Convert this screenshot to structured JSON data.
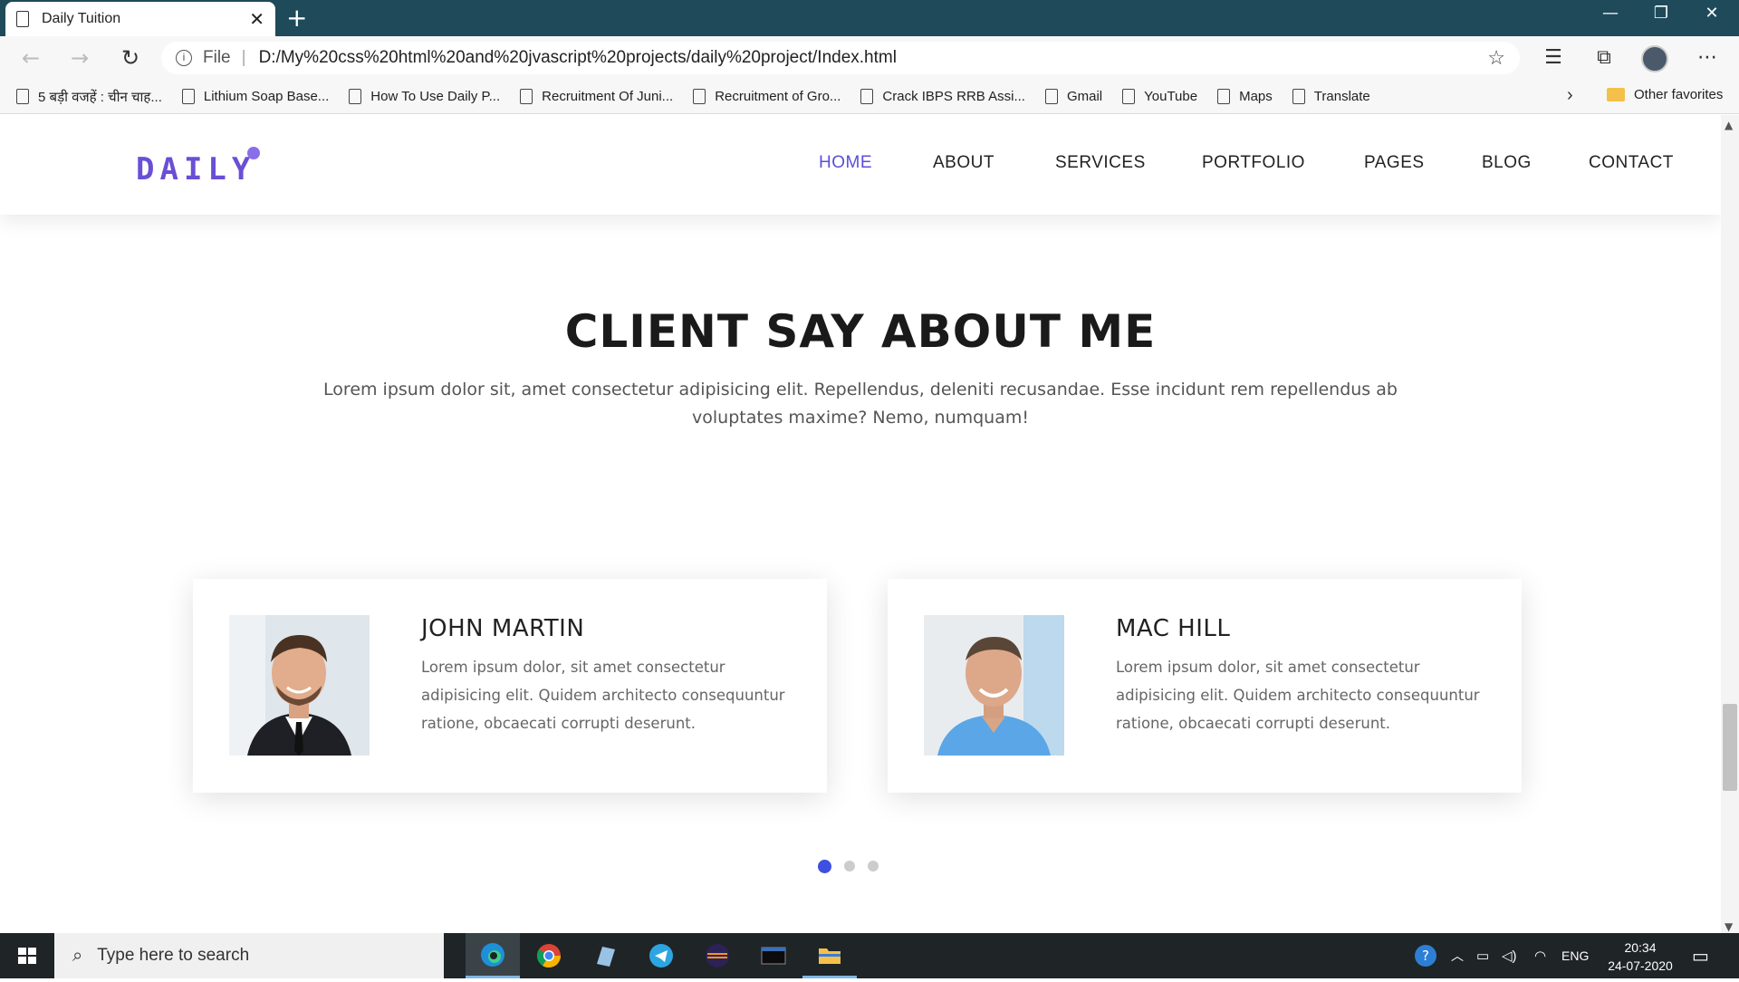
{
  "browser": {
    "tab_title": "Daily Tuition",
    "tab_close": "✕",
    "new_tab": "+",
    "window_controls": {
      "minimize": "—",
      "restore": "❐",
      "close": "✕"
    },
    "address": {
      "scheme_label": "File",
      "url": "D:/My%20css%20html%20and%20jvascript%20projects/daily%20project/Index.html"
    },
    "favorites": [
      "5 बड़ी वजहें : चीन चाह...",
      "Lithium Soap Base...",
      "How To Use Daily P...",
      "Recruitment Of Juni...",
      "Recruitment of Gro...",
      "Crack IBPS RRB Assi...",
      "Gmail",
      "YouTube",
      "Maps",
      "Translate"
    ],
    "other_favorites": "Other favorites"
  },
  "site": {
    "logo": "DAILY",
    "nav": [
      "HOME",
      "ABOUT",
      "SERVICES",
      "PORTFOLIO",
      "PAGES",
      "BLOG",
      "CONTACT"
    ],
    "active_nav": "HOME",
    "section_title": "CLIENT SAY ABOUT ME",
    "section_subtitle": "Lorem ipsum dolor sit, amet consectetur adipisicing elit. Repellendus, deleniti recusandae. Esse incidunt rem repellendus ab voluptates maxime? Nemo, numquam!",
    "testimonials": [
      {
        "name": "JOHN MARTIN",
        "text": "Lorem ipsum dolor, sit amet consectetur adipisicing elit. Quidem architecto consequuntur ratione, obcaecati corrupti deserunt."
      },
      {
        "name": "MAC HILL",
        "text": "Lorem ipsum dolor, sit amet consectetur adipisicing elit. Quidem architecto consequuntur ratione, obcaecati corrupti deserunt."
      }
    ],
    "carousel": {
      "count": 3,
      "active_index": 0
    },
    "colors": {
      "accent": "#5b4fd6",
      "dot_active": "#3f4fe0"
    }
  },
  "taskbar": {
    "search_placeholder": "Type here to search",
    "language": "ENG",
    "time": "20:34",
    "date": "24-07-2020"
  }
}
